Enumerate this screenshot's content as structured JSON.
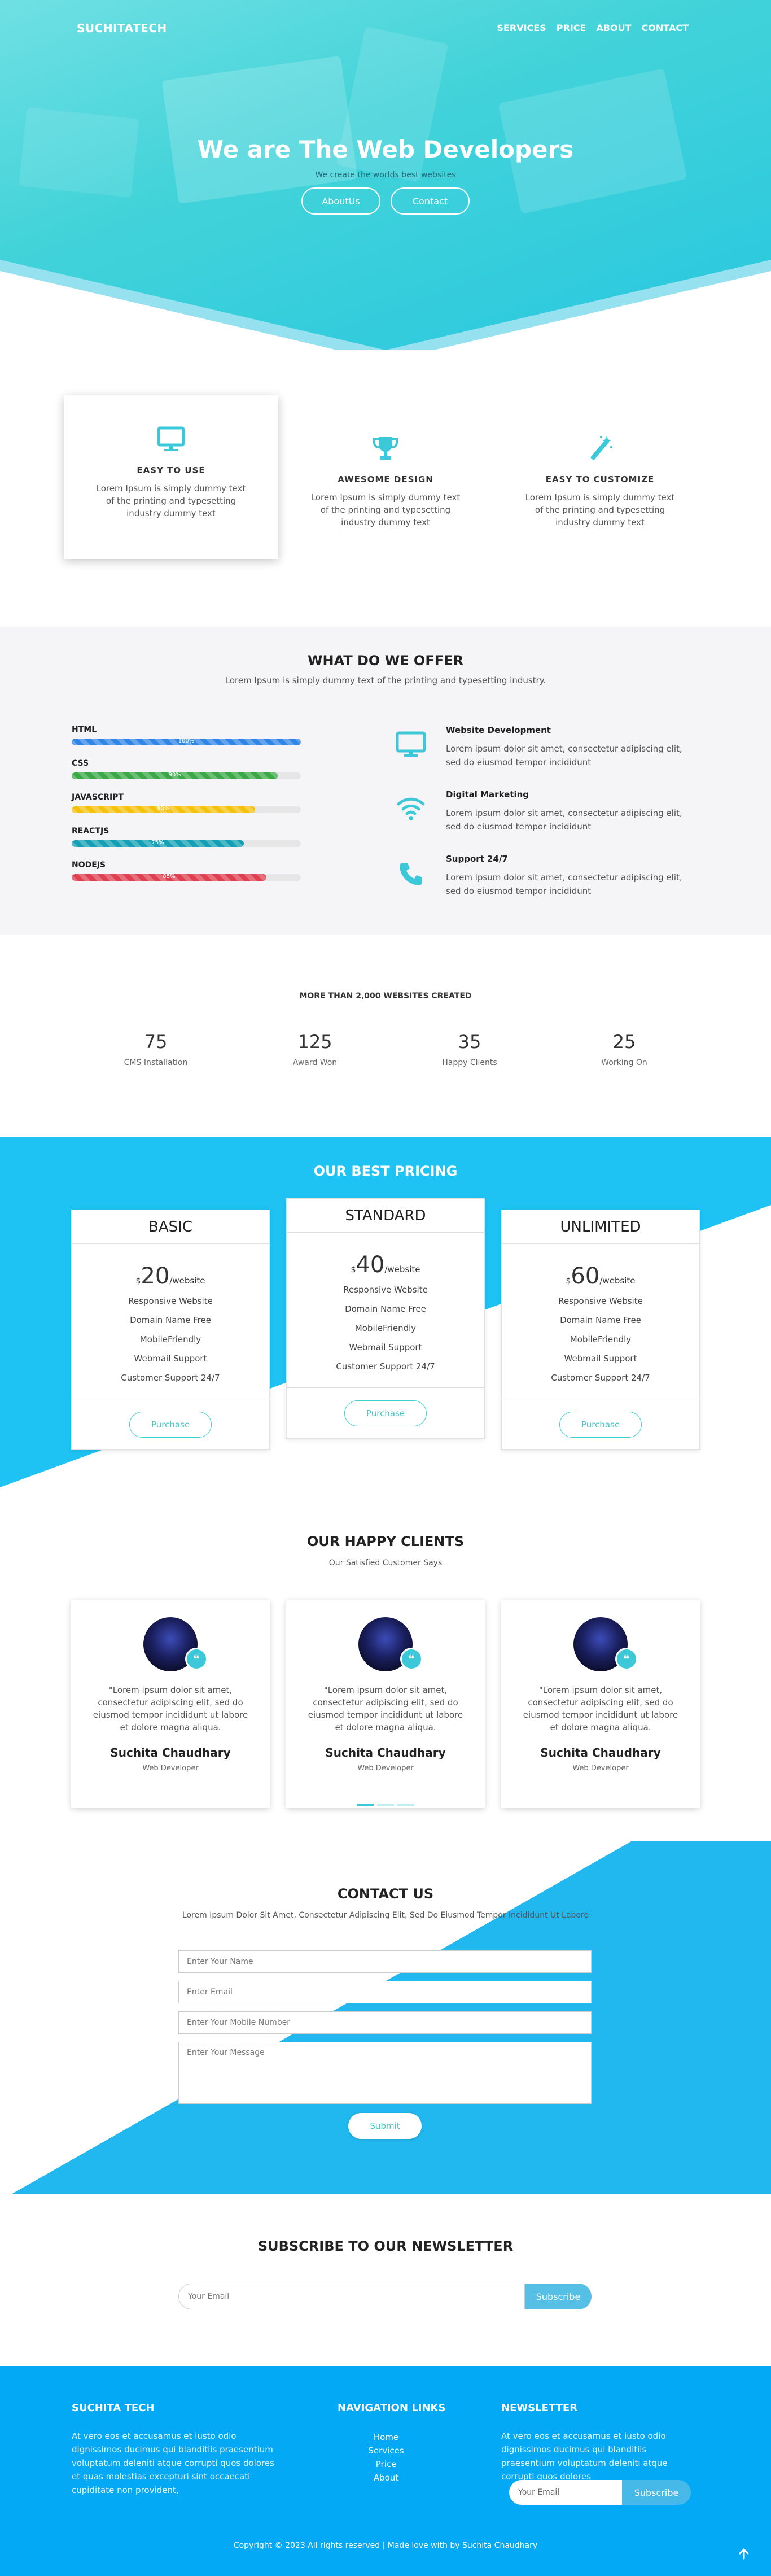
{
  "header": {
    "brand": "SUCHITATECH",
    "nav": [
      "SERVICES",
      "PRICE",
      "ABOUT",
      "CONTACT"
    ]
  },
  "hero": {
    "title": "We are The Web Developers",
    "subtitle": "We create the worlds best websites",
    "buttons": [
      "AboutUs",
      "Contact"
    ]
  },
  "features": [
    {
      "icon": "monitor-icon",
      "title": "EASY  TO  USE",
      "text": "Lorem Ipsum is simply dummy text of the printing and typesetting industry dummy text"
    },
    {
      "icon": "trophy-icon",
      "title": "AWESOME  DESIGN",
      "text": "Lorem Ipsum is simply dummy text of the printing and typesetting industry dummy text"
    },
    {
      "icon": "magic-wand-icon",
      "title": "EASY  TO  CUSTOMIZE",
      "text": "Lorem Ipsum is simply dummy text of the printing and typesetting industry dummy text"
    }
  ],
  "offer": {
    "title": "WHAT DO WE OFFER",
    "subtitle": "Lorem Ipsum is simply dummy text of the printing and typesetting industry.",
    "skills": [
      {
        "label": "HTML",
        "pct": 100,
        "pct_text": "100%",
        "color": "#2f86e6"
      },
      {
        "label": "CSS",
        "pct": 90,
        "pct_text": "90%",
        "color": "#3aa845"
      },
      {
        "label": "JAVASCRIPT",
        "pct": 80,
        "pct_text": "80%",
        "color": "#f4c20d"
      },
      {
        "label": "REACTJS",
        "pct": 75,
        "pct_text": "75%",
        "color": "#14a0b4"
      },
      {
        "label": "NODEJS",
        "pct": 85,
        "pct_text": "85%",
        "color": "#df3f4f"
      }
    ],
    "services": [
      {
        "icon": "monitor-icon",
        "title": "Website  Development",
        "text": "Lorem ipsum dolor sit amet, consectetur adipiscing elit, sed do eiusmod tempor incididunt"
      },
      {
        "icon": "wifi-icon",
        "title": "Digital  Marketing",
        "text": "Lorem ipsum dolor sit amet, consectetur adipiscing elit, sed do eiusmod tempor incididunt"
      },
      {
        "icon": "phone-icon",
        "title": "Support  24/7",
        "text": "Lorem ipsum dolor sit amet, consectetur adipiscing elit, sed do eiusmod tempor incididunt"
      }
    ]
  },
  "stats": {
    "caption": "MORE THAN 2,000 WEBSITES CREATED",
    "items": [
      {
        "number": "75",
        "label": "CMS Installation"
      },
      {
        "number": "125",
        "label": "Award Won"
      },
      {
        "number": "35",
        "label": "Happy Clients"
      },
      {
        "number": "25",
        "label": "Working On"
      }
    ]
  },
  "pricing": {
    "title": "OUR BEST PRICING",
    "plans": [
      {
        "name": "BASIC",
        "currency": "$",
        "amount": "20",
        "per": "/website",
        "features": [
          "Responsive Website",
          "Domain Name Free",
          "MobileFriendly",
          "Webmail Support",
          "Customer Support 24/7"
        ],
        "button": "Purchase"
      },
      {
        "name": "STANDARD",
        "currency": "$",
        "amount": "40",
        "per": "/website",
        "features": [
          "Responsive Website",
          "Domain Name Free",
          "MobileFriendly",
          "Webmail Support",
          "Customer Support 24/7"
        ],
        "button": "Purchase"
      },
      {
        "name": "UNLIMITED",
        "currency": "$",
        "amount": "60",
        "per": "/website",
        "features": [
          "Responsive Website",
          "Domain Name Free",
          "MobileFriendly",
          "Webmail Support",
          "Customer Support 24/7"
        ],
        "button": "Purchase"
      }
    ]
  },
  "clients": {
    "title": "OUR HAPPY CLIENTS",
    "subtitle": "Our Satisfied Customer Says",
    "quote_mark": "❝",
    "items": [
      {
        "quote": "\"Lorem ipsum dolor sit amet, consectetur adipiscing elit, sed do eiusmod tempor incididunt ut labore et dolore magna aliqua.",
        "name": "Suchita Chaudhary",
        "role": "Web Developer"
      },
      {
        "quote": "\"Lorem ipsum dolor sit amet, consectetur adipiscing elit, sed do eiusmod tempor incididunt ut labore et dolore magna aliqua.",
        "name": "Suchita Chaudhary",
        "role": "Web Developer"
      },
      {
        "quote": "\"Lorem ipsum dolor sit amet, consectetur adipiscing elit, sed do eiusmod tempor incididunt ut labore et dolore magna aliqua.",
        "name": "Suchita Chaudhary",
        "role": "Web Developer"
      }
    ]
  },
  "contact": {
    "title": "CONTACT US",
    "subtitle": "Lorem Ipsum Dolor Sit Amet, Consectetur Adipiscing Elit, Sed Do Eiusmod Tempor Incididunt Ut Labore",
    "name_placeholder": "Enter Your Name",
    "email_placeholder": "Enter Email",
    "mobile_placeholder": "Enter Your Mobile Number",
    "message_placeholder": "Enter Your Message",
    "submit": "Submit"
  },
  "newsletter": {
    "title": "SUBSCRIBE TO OUR NEWSLETTER",
    "placeholder": "Your Email",
    "button": "Subscribe"
  },
  "footer": {
    "brand": "SUCHITA TECH",
    "about": "At vero eos et accusamus et iusto odio dignissimos ducimus qui blanditiis praesentium voluptatum deleniti atque corrupti quos dolores et quas molestias excepturi sint occaecati cupiditate non provident,",
    "nav_title": "NAVIGATION LINKS",
    "nav_links": [
      "Home",
      "Services",
      "Price",
      "About"
    ],
    "newsletter_title": "NEWSLETTER",
    "newsletter_text": "At vero eos et accusamus et iusto odio dignissimos ducimus qui blanditiis praesentium voluptatum deleniti atque corrupti quos dolores",
    "email_placeholder": "Your Email",
    "subscribe": "Subscribe",
    "copyright": "Copyright © 2023 All rights reserved | Made love with by Suchita Chaudhary",
    "to_top_icon": "arrow-up-icon"
  },
  "colors": {
    "accent": "#3cc8d8",
    "pricing_bg": "#1ec3f3",
    "contact_bg": "#21b8f0",
    "footer_bg": "#03a9f4"
  }
}
